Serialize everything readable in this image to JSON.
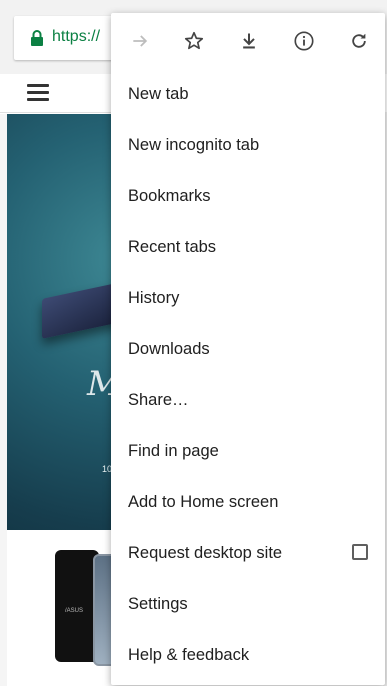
{
  "browser": {
    "url": "https://",
    "url_color": "#0b8043"
  },
  "hero": {
    "script_text": "M",
    "small_text": "10"
  },
  "products": {
    "phone_brand": "/ASUS"
  },
  "menu": {
    "toolbar": [
      {
        "name": "forward",
        "icon": "arrow-right-icon",
        "enabled": false
      },
      {
        "name": "bookmark",
        "icon": "star-icon",
        "enabled": true
      },
      {
        "name": "download",
        "icon": "download-icon",
        "enabled": true
      },
      {
        "name": "page-info",
        "icon": "info-icon",
        "enabled": true
      },
      {
        "name": "reload",
        "icon": "refresh-icon",
        "enabled": true
      }
    ],
    "items": [
      {
        "label": "New tab"
      },
      {
        "label": "New incognito tab"
      },
      {
        "label": "Bookmarks"
      },
      {
        "label": "Recent tabs"
      },
      {
        "label": "History"
      },
      {
        "label": "Downloads"
      },
      {
        "label": "Share…"
      },
      {
        "label": "Find in page"
      },
      {
        "label": "Add to Home screen"
      },
      {
        "label": "Request desktop site",
        "checkbox": true,
        "checked": false
      },
      {
        "label": "Settings"
      },
      {
        "label": "Help & feedback"
      }
    ]
  }
}
